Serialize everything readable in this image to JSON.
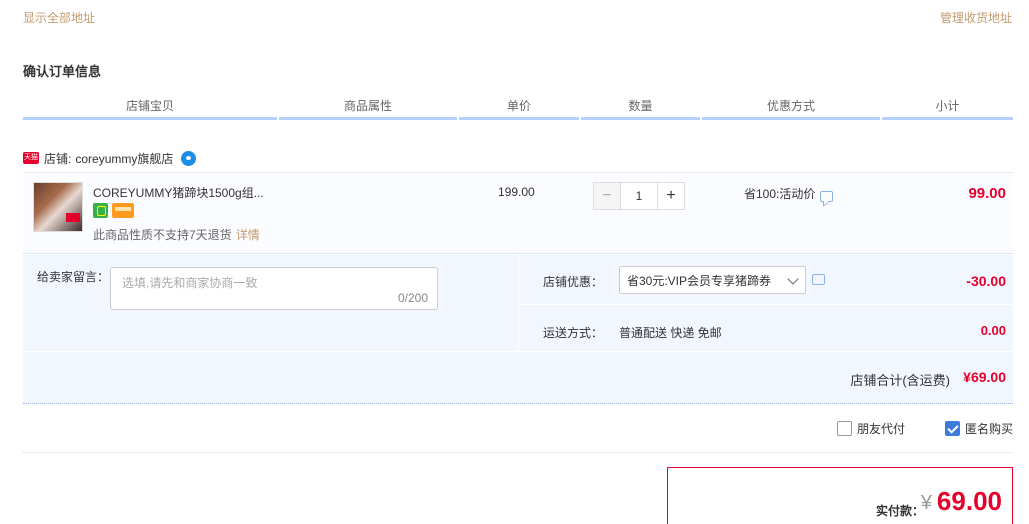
{
  "top_links": {
    "show_all_address": "显示全部地址",
    "manage_address": "管理收货地址"
  },
  "section_title": "确认订单信息",
  "columns": [
    "店铺宝贝",
    "商品属性",
    "单价",
    "数量",
    "优惠方式",
    "小计"
  ],
  "store": {
    "badge": "天猫",
    "label": "店铺:",
    "name": "coreyummy旗舰店"
  },
  "item": {
    "title": "COREYUMMY猪蹄块1500g组...",
    "return_note": "此商品性质不支持7天退货",
    "detail_link": "详情",
    "unit_price": "199.00",
    "quantity": "1",
    "qty_minus": "−",
    "qty_plus": "+",
    "promo": "省100:活动价",
    "subtotal": "99.00"
  },
  "message": {
    "label": "给卖家留言：",
    "placeholder": "选填,请先和商家协商一致",
    "count": "0/200"
  },
  "coupon": {
    "label": "店铺优惠：",
    "selected": "省30元:VIP会员专享猪蹄券",
    "amount": "-30.00"
  },
  "shipping": {
    "label": "运送方式：",
    "method": "普通配送 快递 免邮",
    "amount": "0.00"
  },
  "store_total": {
    "label": "店铺合计(含运费)",
    "amount": "¥69.00"
  },
  "options": {
    "friend_pay": "朋友代付",
    "friend_pay_checked": false,
    "anonymous": "匿名购买",
    "anonymous_checked": true
  },
  "payment": {
    "label": "实付款：",
    "currency": "¥",
    "amount": "69.00"
  },
  "colors": {
    "accent_red": "#e4002b",
    "link_brown": "#c49a6c",
    "panel_blue": "#f2f7ff",
    "check_blue": "#3d7bdc"
  }
}
